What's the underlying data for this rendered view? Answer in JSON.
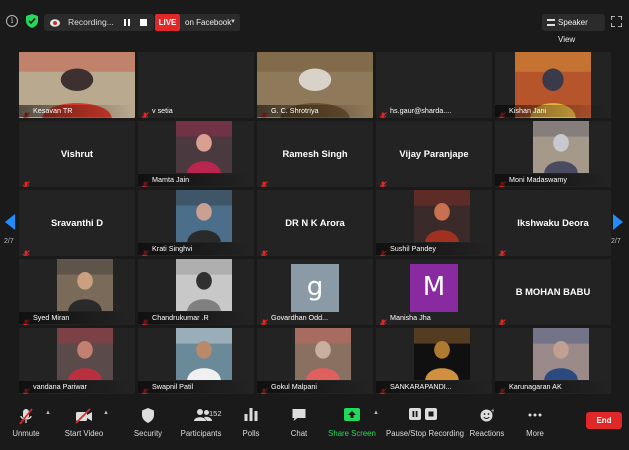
{
  "topbar": {
    "recording_label": "Recording...",
    "live_badge": "LIVE",
    "live_destination": "on Facebook",
    "view_button": "Speaker View"
  },
  "pagination": {
    "current": "2/7"
  },
  "colors": {
    "live_red": "#e02828",
    "accent_blue": "#1f8cff",
    "share_green": "#23d959",
    "end_red": "#e02828",
    "tile_bg": "#232323"
  },
  "participants": [
    {
      "name": "Kesavan TR",
      "has_video": true
    },
    {
      "name": "v setia",
      "has_video": false,
      "show_big": false
    },
    {
      "name": "G. C. Shrotriya",
      "has_video": true
    },
    {
      "name": "hs.gaur@sharda....",
      "has_video": false,
      "show_big": false
    },
    {
      "name": "Kishan Jani",
      "has_video": true
    },
    {
      "name": "Vishrut",
      "has_video": false,
      "show_big": true
    },
    {
      "name": "Mamta Jain",
      "has_video": true
    },
    {
      "name": "Ramesh Singh",
      "has_video": false,
      "show_big": true
    },
    {
      "name": "Vijay Paranjape",
      "has_video": false,
      "show_big": true
    },
    {
      "name": "Moni Madaswamy",
      "has_video": true
    },
    {
      "name": "Sravanthi D",
      "has_video": false,
      "show_big": true
    },
    {
      "name": "Krati Singhvi",
      "has_video": true
    },
    {
      "name": "DR N K Arora",
      "has_video": false,
      "show_big": true
    },
    {
      "name": "Sushil Pandey",
      "has_video": true
    },
    {
      "name": "Ikshwaku Deora",
      "has_video": false,
      "show_big": true
    },
    {
      "name": "Syed Miran",
      "has_video": true
    },
    {
      "name": "Chandrukumar .R",
      "has_video": true
    },
    {
      "name": "Govardhan Odd...",
      "has_video": false,
      "avatar_letter": "g"
    },
    {
      "name": "Manisha Jha",
      "has_video": false,
      "avatar_letter": "M"
    },
    {
      "name": "B MOHAN BABU",
      "has_video": false,
      "show_big": true,
      "no_footer": true
    },
    {
      "name": "vandana Pariwar",
      "has_video": true
    },
    {
      "name": "Swapnil Patil",
      "has_video": true
    },
    {
      "name": "Gokul Malpani",
      "has_video": true
    },
    {
      "name": "SANKARAPANDI...",
      "has_video": true
    },
    {
      "name": "Karunagaran AK",
      "has_video": true
    }
  ],
  "toolbar": {
    "unmute": "Unmute",
    "start_video": "Start Video",
    "security": "Security",
    "participants": "Participants",
    "participants_count": "152",
    "polls": "Polls",
    "chat": "Chat",
    "share_screen": "Share Screen",
    "pause_recording": "Pause/Stop Recording",
    "reactions": "Reactions",
    "more": "More",
    "end": "End"
  }
}
